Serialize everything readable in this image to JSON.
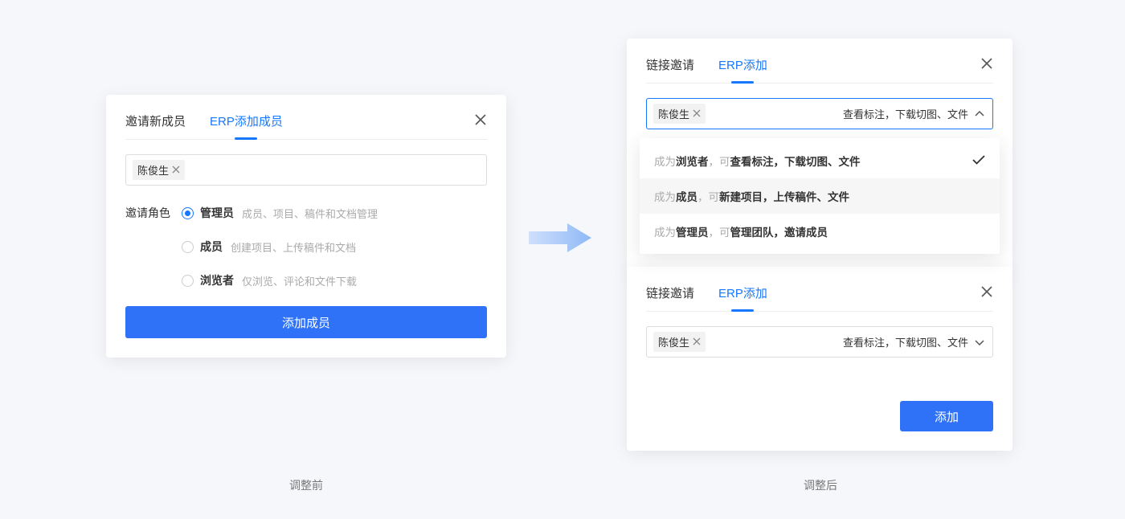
{
  "left": {
    "tabs": [
      "邀请新成员",
      "ERP添加成员"
    ],
    "activeTab": 1,
    "chip": "陈俊生",
    "roleLabel": "邀请角色",
    "roles": [
      {
        "name": "管理员",
        "desc": "成员、项目、稿件和文档管理",
        "checked": true
      },
      {
        "name": "成员",
        "desc": "创建项目、上传稿件和文档",
        "checked": false
      },
      {
        "name": "浏览者",
        "desc": "仅浏览、评论和文件下载",
        "checked": false
      }
    ],
    "submit": "添加成员"
  },
  "rightTop": {
    "tabs": [
      "链接邀请",
      "ERP添加"
    ],
    "activeTab": 1,
    "chip": "陈俊生",
    "comboText": "查看标注，下载切图、文件",
    "options": [
      {
        "prefix": "成为",
        "role": "浏览者",
        "mid": "，可",
        "action": "查看标注，下载切图、文件",
        "selected": true,
        "hover": false
      },
      {
        "prefix": "成为",
        "role": "成员",
        "mid": "，可",
        "action": "新建项目，上传稿件、文件",
        "selected": false,
        "hover": true
      },
      {
        "prefix": "成为",
        "role": "管理员",
        "mid": "，可",
        "action": "管理团队，邀请成员",
        "selected": false,
        "hover": false
      }
    ]
  },
  "rightBottom": {
    "tabs": [
      "链接邀请",
      "ERP添加"
    ],
    "activeTab": 1,
    "chip": "陈俊生",
    "comboText": "查看标注，下载切图、文件",
    "submit": "添加"
  },
  "captions": {
    "left": "调整前",
    "right": "调整后"
  }
}
